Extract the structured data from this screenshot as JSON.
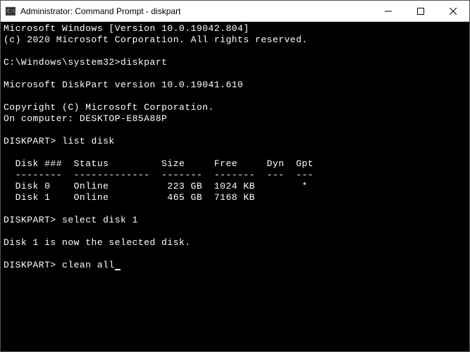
{
  "window": {
    "title": "Administrator: Command Prompt - diskpart"
  },
  "terminal": {
    "line1": "Microsoft Windows [Version 10.0.19042.804]",
    "line2": "(c) 2020 Microsoft Corporation. All rights reserved.",
    "line3": "",
    "prompt1_path": "C:\\Windows\\system32>",
    "prompt1_cmd": "diskpart",
    "line5": "",
    "line6": "Microsoft DiskPart version 10.0.19041.610",
    "line7": "",
    "line8": "Copyright (C) Microsoft Corporation.",
    "line9": "On computer: DESKTOP-E85A88P",
    "line10": "",
    "prompt2_label": "DISKPART> ",
    "prompt2_cmd": "list disk",
    "line12": "",
    "table_header": "  Disk ###  Status         Size     Free     Dyn  Gpt",
    "table_divider": "  --------  -------------  -------  -------  ---  ---",
    "table_row1": "  Disk 0    Online          223 GB  1024 KB        *",
    "table_row2": "  Disk 1    Online          465 GB  7168 KB",
    "line17": "",
    "prompt3_label": "DISKPART> ",
    "prompt3_cmd": "select disk 1",
    "line19": "",
    "line20": "Disk 1 is now the selected disk.",
    "line21": "",
    "prompt4_label": "DISKPART> ",
    "prompt4_cmd": "clean all"
  }
}
